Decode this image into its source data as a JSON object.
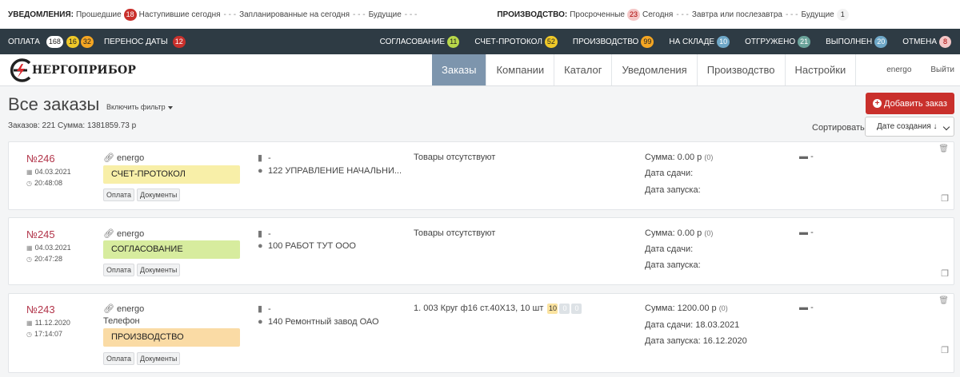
{
  "notifications": {
    "label": "УВЕДОМЛЕНИЯ:",
    "items": [
      {
        "text": "Прошедшие",
        "count": "18"
      },
      {
        "text": "Наступившие сегодня"
      },
      {
        "text": "Запланированные на сегодня"
      },
      {
        "text": "Будущие"
      }
    ],
    "production_label": "ПРОИЗВОДСТВО:",
    "production_items": [
      {
        "text": "Просроченные",
        "count": "23"
      },
      {
        "text": "Сегодня"
      },
      {
        "text": "Завтра или послезавтра"
      },
      {
        "text": "Будущие",
        "count": "1"
      }
    ],
    "separator": "- - -"
  },
  "status_bar": {
    "left": [
      {
        "label": "ОПЛАТА",
        "counts": [
          "168",
          "16",
          "32"
        ]
      },
      {
        "label": "ПЕРЕНОС ДАТЫ",
        "counts": [
          "12"
        ]
      }
    ],
    "right": [
      {
        "label": "СОГЛАСОВАНИЕ",
        "count": "11"
      },
      {
        "label": "СЧЕТ-ПРОТОКОЛ",
        "count": "52"
      },
      {
        "label": "ПРОИЗВОДСТВО",
        "count": "99"
      },
      {
        "label": "НА СКЛАДЕ",
        "count": "10"
      },
      {
        "label": "ОТГРУЖЕНО",
        "count": "21"
      },
      {
        "label": "ВЫПОЛНЕН",
        "count": "20"
      },
      {
        "label": "ОТМЕНА",
        "count": "8"
      }
    ]
  },
  "nav": {
    "logo_text": "НЕРГОПРИБОР",
    "tabs": [
      "Заказы",
      "Компании",
      "Каталог",
      "Уведомления",
      "Производство",
      "Настройки"
    ],
    "user": "energo",
    "logout": "Выйти"
  },
  "header": {
    "title": "Все заказы",
    "filter": "Включить фильтр",
    "summary": "Заказов: 221   Сумма: 1381859.73 р",
    "add_button": "Добавить заказ",
    "sort_label": "Сортировать",
    "sort_value": "Дате создания ↓"
  },
  "orders": [
    {
      "number": "№246",
      "date": "04.03.2021",
      "time": "20:48:08",
      "source": "energo",
      "status": "СЧЕТ-ПРОТОКОЛ",
      "tags": [
        "Оплата",
        "Документы"
      ],
      "doc": "-",
      "customer": "122 УПРАВЛЕНИЕ НАЧАЛЬНИ...",
      "goods": "Товары отсутствуют",
      "sum": "Сумма: 0.00 р",
      "sum_count": "(0)",
      "due": "Дата сдачи:",
      "launch": "Дата запуска:",
      "comment": "-"
    },
    {
      "number": "№245",
      "date": "04.03.2021",
      "time": "20:47:28",
      "source": "energo",
      "status": "СОГЛАСОВАНИЕ",
      "tags": [
        "Оплата",
        "Документы"
      ],
      "doc": "-",
      "customer": "100 РАБОТ ТУТ ООО",
      "goods": "Товары отсутствуют",
      "sum": "Сумма: 0.00 р",
      "sum_count": "(0)",
      "due": "Дата сдачи:",
      "launch": "Дата запуска:",
      "comment": "-"
    },
    {
      "number": "№243",
      "date": "11.12.2020",
      "time": "17:14:07",
      "source": "energo",
      "phone": "Телефон",
      "status": "ПРОИЗВОДСТВО",
      "tags": [
        "Оплата",
        "Документы"
      ],
      "doc": "-",
      "customer": "140 Ремонтный завод ОАО",
      "goods": "1. 003 Круг ф16 ст.40Х13, 10 шт",
      "goods_badges": [
        "10",
        "0",
        "0"
      ],
      "sum": "Сумма: 1200.00 р",
      "sum_count": "(0)",
      "due": "Дата сдачи: 18.03.2021",
      "launch": "Дата запуска: 16.12.2020",
      "comment": "-"
    }
  ]
}
